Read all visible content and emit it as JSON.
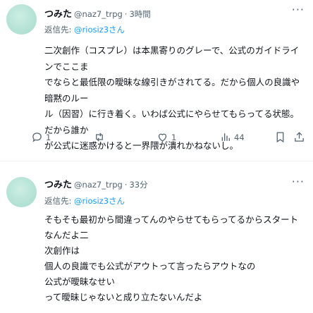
{
  "tweets": [
    {
      "display_name": "つみた",
      "handle": "@naz7_trpg",
      "dot": "·",
      "time": "3時間",
      "more": "···",
      "reply_prefix": "返信先:",
      "reply_handle": "@riosiz3",
      "reply_suffix": "さん",
      "lines": [
        "二次創作（コスプレ）は本黒寄りのグレーで、公式のガイドラインでここま",
        "でならと最低限の曖昧な線引きがされてる。だから個人の良識や暗黙のルー",
        "ル（因習）に行き着く。いわば公式にやらせてもらってる状態。だから誰か",
        "が公式に迷惑かけると一界隈が潰れかねないし。"
      ],
      "actions": {
        "reply_count": "1",
        "retweet_count": "",
        "like_count": "1",
        "views_count": "44"
      }
    },
    {
      "display_name": "つみた",
      "handle": "@naz7_trpg",
      "dot": "·",
      "time": "33分",
      "more": "···",
      "reply_prefix": "返信先:",
      "reply_handle": "@riosiz3",
      "reply_suffix": "さん",
      "lines": [
        "そもそも最初から間違ってんのやらせてもらってるからスタートなんだよ二",
        "次創作は",
        "個人の良識でも公式がアウトって言ったらアウトなの",
        "公式が曖昧なせい",
        "って曖昧じゃないと成り立たないんだよ"
      ]
    }
  ],
  "colors": {
    "text": "#0f1419",
    "secondary": "#536471",
    "link": "#1d9bf0",
    "avatar": "#b6e3d6"
  },
  "icons": [
    "more-icon",
    "reply-icon",
    "retweet-icon",
    "like-icon",
    "views-icon",
    "bookmark-icon",
    "share-icon"
  ]
}
